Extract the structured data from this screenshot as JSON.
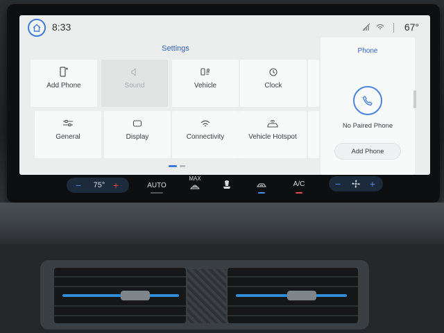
{
  "status": {
    "clock": "8:33",
    "outside_temp": "67°"
  },
  "settings": {
    "title": "Settings",
    "tiles": [
      {
        "label": "Add Phone",
        "icon": "add-phone-icon",
        "enabled": true
      },
      {
        "label": "Sound",
        "icon": "speaker-icon",
        "enabled": false
      },
      {
        "label": "Vehicle",
        "icon": "vehicle-icon",
        "enabled": true
      },
      {
        "label": "Clock",
        "icon": "clock-icon",
        "enabled": true
      },
      {
        "label": "General",
        "icon": "sliders-icon",
        "enabled": true
      },
      {
        "label": "Display",
        "icon": "display-icon",
        "enabled": true
      },
      {
        "label": "Connectivity",
        "icon": "wifi-icon",
        "enabled": true
      },
      {
        "label": "Vehicle Hotspot",
        "icon": "hotspot-icon",
        "enabled": true
      }
    ]
  },
  "phone_panel": {
    "title": "Phone",
    "status": "No Paired Phone",
    "button": "Add Phone"
  },
  "climate": {
    "driver_temp": "75°",
    "auto": "AUTO",
    "max": "MAX",
    "ac": "A/C"
  },
  "colors": {
    "accent": "#3f7ad9",
    "screen_bg": "#eceeed",
    "tile_bg": "#f8f9f9",
    "heat": "#e34b4b",
    "cool": "#4a8bf0"
  }
}
